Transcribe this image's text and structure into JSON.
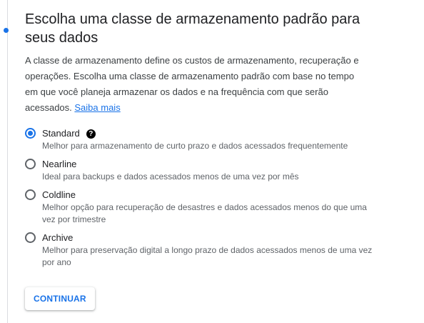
{
  "step": {
    "title": "Escolha uma classe de armazenamento padrão para seus dados",
    "description": "A classe de armazenamento define os custos de armazenamento, recuperação e operações. Escolha uma classe de armazenamento padrão com base no tempo em que você planeja armazenar os dados e na frequência com que serão acessados.",
    "learn_more": "Saiba mais"
  },
  "options": [
    {
      "label": "Standard",
      "description": "Melhor para armazenamento de curto prazo e dados acessados frequentemente",
      "selected": true,
      "help_icon": "question-circle-icon"
    },
    {
      "label": "Nearline",
      "description": "Ideal para backups e dados acessados menos de uma vez por mês",
      "selected": false
    },
    {
      "label": "Coldline",
      "description": "Melhor opção para recuperação de desastres e dados acessados menos do que uma vez por trimestre",
      "selected": false
    },
    {
      "label": "Archive",
      "description": "Melhor para preservação digital a longo prazo de dados acessados menos de uma vez por ano",
      "selected": false
    }
  ],
  "continue_label": "CONTINUAR",
  "colors": {
    "accent": "#1a73e8",
    "text": "#202124",
    "secondary_text": "#5f6368"
  }
}
